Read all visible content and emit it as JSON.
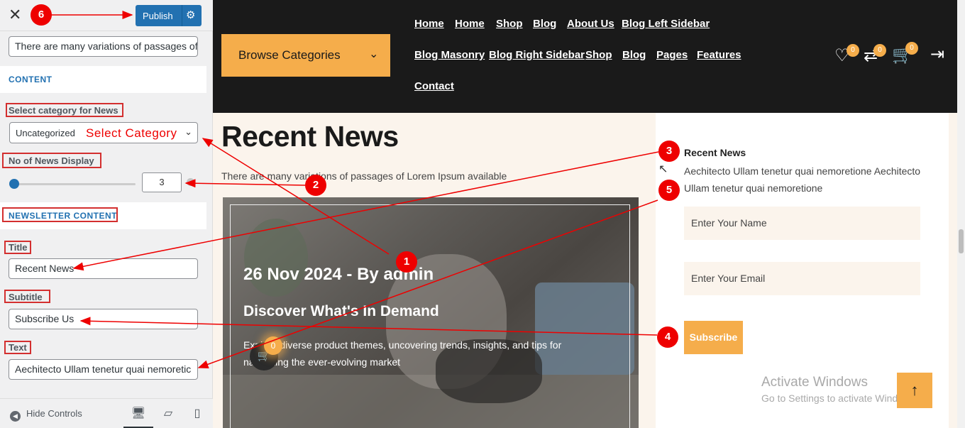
{
  "panel": {
    "publish_label": "Publish",
    "text_field_value_top": "There are many variations of passages of",
    "section_content": "CONTENT",
    "category_label": "Select category for News",
    "category_value": "Uncategorized",
    "category_annotation": "Select Category",
    "count_label": "No of News Display",
    "count_value": "3",
    "section_newsletter": "NEWSLETTER CONTENT",
    "title_label": "Title",
    "title_value": "Recent News",
    "subtitle_label": "Subtitle",
    "subtitle_value": "Subscribe Us",
    "text_label": "Text",
    "text_value": "Aechitecto Ullam tenetur quai nemoretic",
    "hide_controls": "Hide Controls"
  },
  "header": {
    "browse_label": "Browse Categories",
    "nav": [
      "Home",
      "Home",
      "Shop",
      "Blog",
      "About Us",
      "Blog Left Sidebar",
      "Blog Masonry",
      "Blog Right Sidebar",
      "Shop",
      "Blog",
      "Pages",
      "Features",
      "Contact"
    ],
    "wishlist_count": "0",
    "compare_count": "0",
    "cart_count": "0"
  },
  "main": {
    "title": "Recent News",
    "subtitle": "There are many variations of passages of Lorem Ipsum available",
    "card": {
      "meta": "26 Nov 2024 - By admin",
      "heading": "Discover What's In Demand",
      "excerpt": "Explore diverse product themes, uncovering trends, insights, and tips for navigating the ever-evolving market"
    },
    "floating_cart_count": "0"
  },
  "sidebar": {
    "title": "Recent News",
    "text": "Aechitecto Ullam tenetur quai nemoretione Aechitecto Ullam tenetur quai nemoretione",
    "name_placeholder": "Enter Your Name",
    "email_placeholder": "Enter Your Email",
    "subscribe_label": "Subscribe"
  },
  "watermark": {
    "line1": "Activate Windows",
    "line2": "Go to Settings to activate Windows."
  },
  "markers": [
    "1",
    "2",
    "3",
    "4",
    "5",
    "6"
  ],
  "icons": {
    "close": "close-icon",
    "gear": "gear-icon",
    "chevron": "chevron-down-icon",
    "wishlist": "heart-icon",
    "compare": "compare-arrows-icon",
    "cart": "cart-icon",
    "logout": "logout-icon",
    "to_top": "arrow-up-icon",
    "desktop": "desktop-icon",
    "tablet": "tablet-icon",
    "mobile": "mobile-icon"
  },
  "colors": {
    "accent": "#f5ad4b",
    "publish": "#2271b1",
    "annotation": "#e00000",
    "header_bg": "#1a1a1a"
  }
}
